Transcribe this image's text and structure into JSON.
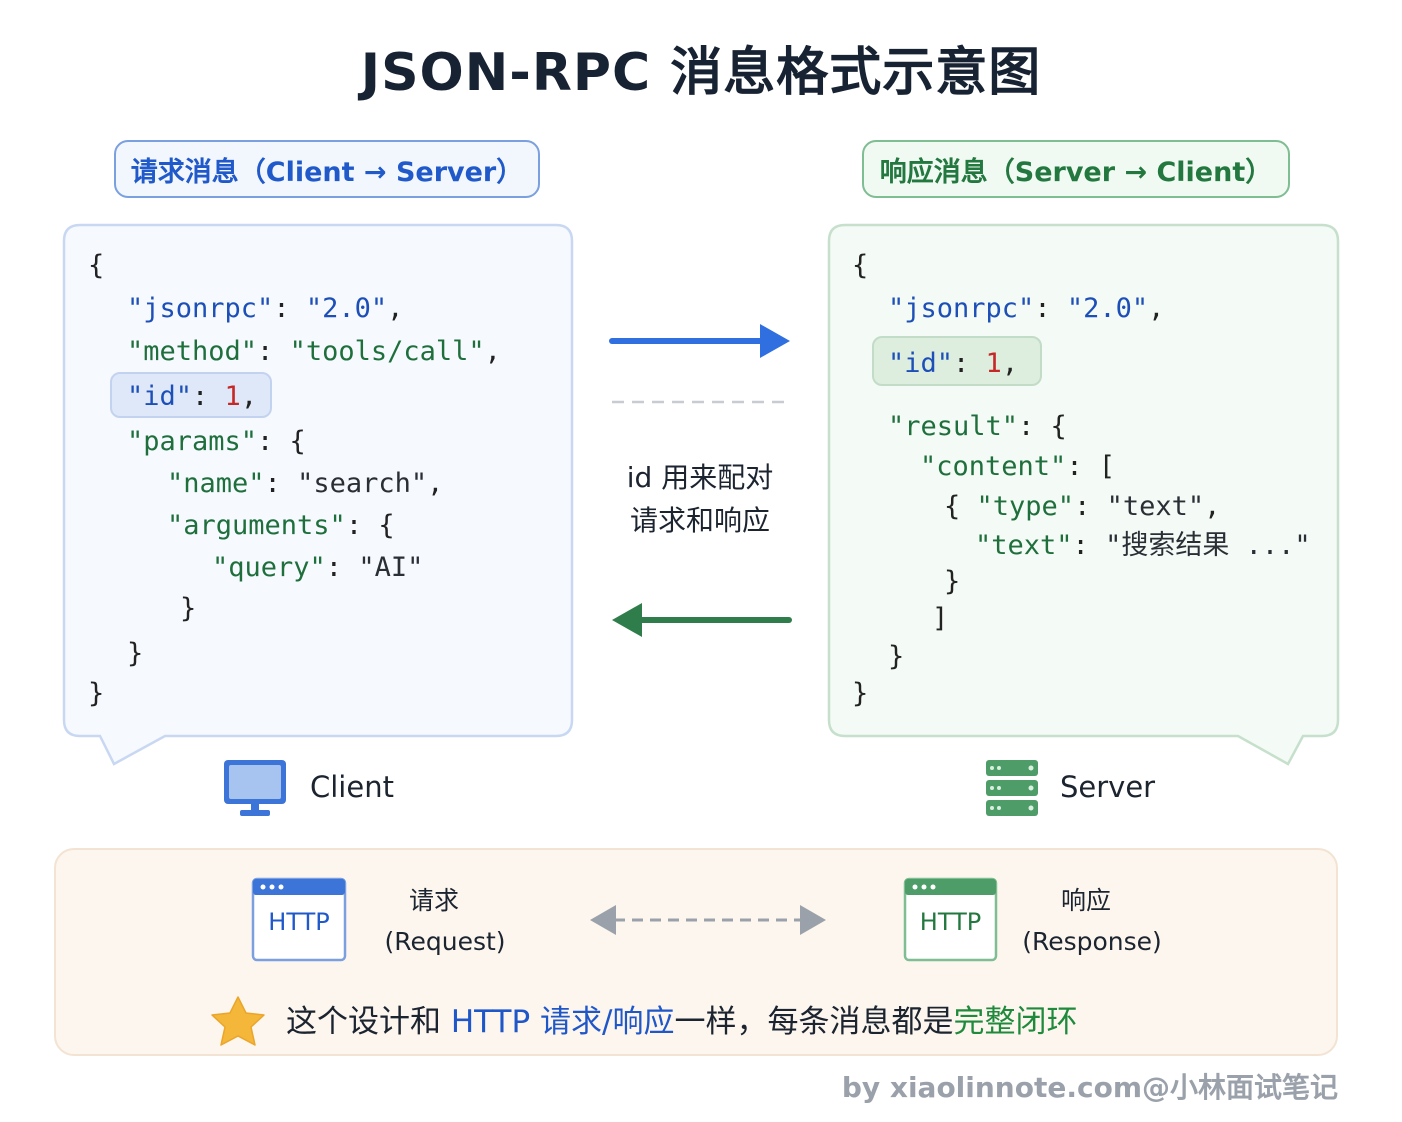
{
  "title": "JSON-RPC 消息格式示意图",
  "request": {
    "tag": "请求消息（Client → Server）",
    "lines": [
      [
        {
          "t": "{",
          "c": "p"
        }
      ],
      [
        {
          "t": "\"jsonrpc\"",
          "c": "k-b"
        },
        {
          "t": ": ",
          "c": "p"
        },
        {
          "t": "\"2.0\"",
          "c": "s"
        },
        {
          "t": ",",
          "c": "p"
        }
      ],
      [
        {
          "t": "\"method\"",
          "c": "k-g"
        },
        {
          "t": ": ",
          "c": "p"
        },
        {
          "t": "\"tools/call\"",
          "c": "k-g"
        },
        {
          "t": ",",
          "c": "p"
        }
      ],
      [
        {
          "t": "\"id\"",
          "c": "k-b"
        },
        {
          "t": ": ",
          "c": "p"
        },
        {
          "t": "1",
          "c": "n"
        },
        {
          "t": ",",
          "c": "p"
        }
      ],
      [
        {
          "t": "\"params\"",
          "c": "k-g"
        },
        {
          "t": ": {",
          "c": "p"
        }
      ],
      [
        {
          "t": "\"name\"",
          "c": "k-g"
        },
        {
          "t": ": ",
          "c": "p"
        },
        {
          "t": "\"search\"",
          "c": "sp"
        },
        {
          "t": ",",
          "c": "p"
        }
      ],
      [
        {
          "t": "\"arguments\"",
          "c": "k-g"
        },
        {
          "t": ": {",
          "c": "p"
        }
      ],
      [
        {
          "t": "\"query\"",
          "c": "k-g"
        },
        {
          "t": ": ",
          "c": "p"
        },
        {
          "t": "\"AI\"",
          "c": "sp"
        }
      ],
      [
        {
          "t": "}",
          "c": "p"
        }
      ],
      [
        {
          "t": "}",
          "c": "p"
        }
      ],
      [
        {
          "t": "}",
          "c": "p"
        }
      ]
    ]
  },
  "response": {
    "tag": "响应消息（Server → Client）",
    "lines": [
      [
        {
          "t": "{",
          "c": "p"
        }
      ],
      [
        {
          "t": "\"jsonrpc\"",
          "c": "k-b"
        },
        {
          "t": ": ",
          "c": "p"
        },
        {
          "t": "\"2.0\"",
          "c": "s"
        },
        {
          "t": ",",
          "c": "p"
        }
      ],
      [
        {
          "t": "\"id\"",
          "c": "k-b"
        },
        {
          "t": ": ",
          "c": "p"
        },
        {
          "t": "1",
          "c": "n"
        },
        {
          "t": ",",
          "c": "p"
        }
      ],
      [
        {
          "t": "\"result\"",
          "c": "k-g"
        },
        {
          "t": ": {",
          "c": "p"
        }
      ],
      [
        {
          "t": "\"content\"",
          "c": "k-g"
        },
        {
          "t": ": [",
          "c": "p"
        }
      ],
      [
        {
          "t": "{ ",
          "c": "p"
        },
        {
          "t": "\"type\"",
          "c": "k-g"
        },
        {
          "t": ": ",
          "c": "p"
        },
        {
          "t": "\"text\"",
          "c": "sp"
        },
        {
          "t": ",",
          "c": "p"
        }
      ],
      [
        {
          "t": "\"text\"",
          "c": "k-g"
        },
        {
          "t": ": ",
          "c": "p"
        },
        {
          "t": "\"搜索结果 ...\"",
          "c": "sp"
        }
      ],
      [
        {
          "t": "}",
          "c": "p"
        }
      ],
      [
        {
          "t": "]",
          "c": "p"
        }
      ],
      [
        {
          "t": "}",
          "c": "p"
        }
      ],
      [
        {
          "t": "}",
          "c": "p"
        }
      ]
    ]
  },
  "middle": {
    "line1": "id 用来配对",
    "line2": "请求和响应"
  },
  "client_label": "Client",
  "server_label": "Server",
  "http": {
    "icon_text": "HTTP",
    "request_cn": "请求",
    "request_en": "(Request)",
    "response_cn": "响应",
    "response_en": "(Response)"
  },
  "note": {
    "part1": "这个设计和 ",
    "part2": "HTTP 请求/响应",
    "part3": "一样，每条消息都是",
    "part4": "完整闭环"
  },
  "footer": "by xiaolinnote.com@小林面试笔记",
  "colors": {
    "blue": "#2f6fe0",
    "green": "#2e7d4a",
    "req_bg": "#f6f9fe",
    "res_bg": "#f4faf5"
  }
}
